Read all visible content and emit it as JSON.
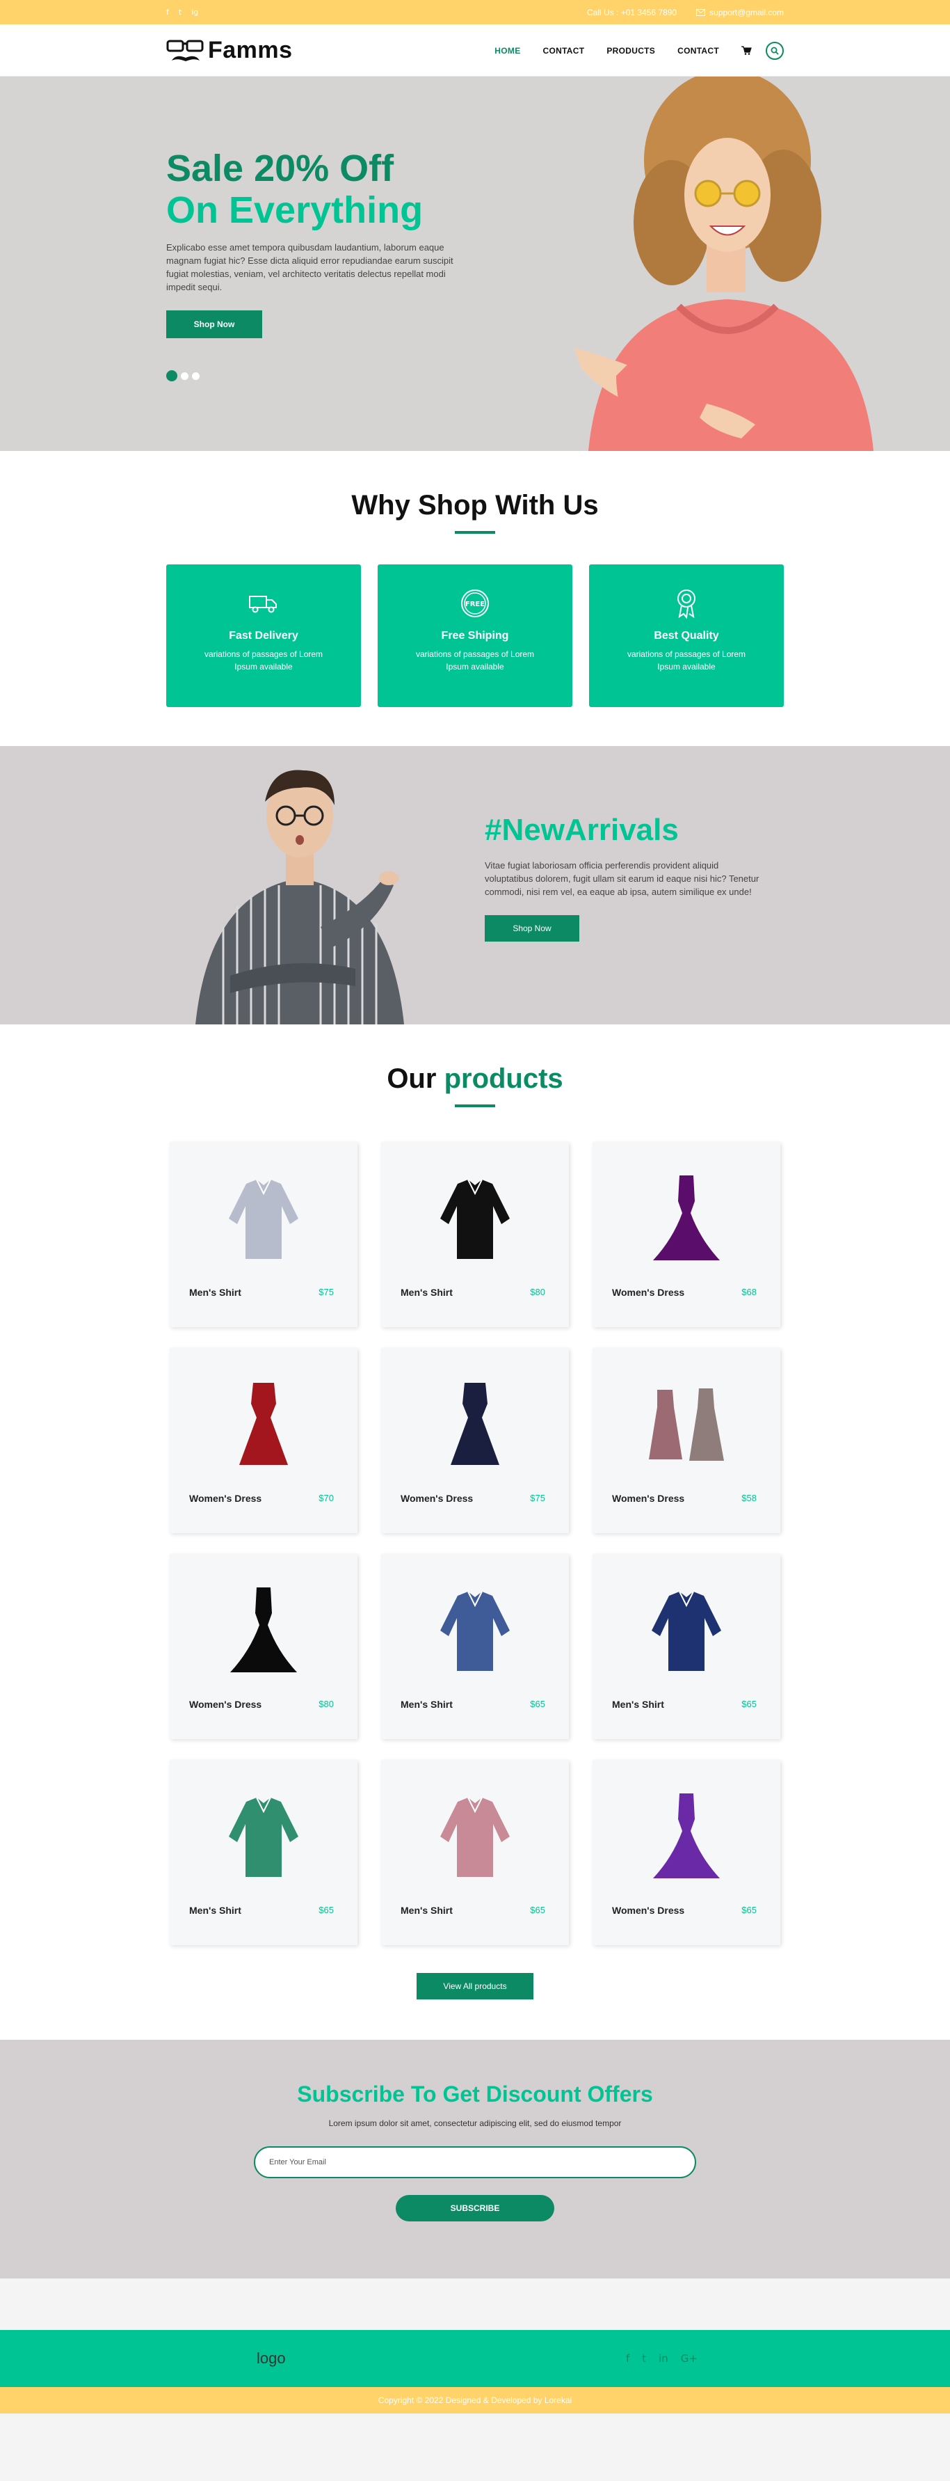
{
  "topbar": {
    "social": [
      "f",
      "t",
      "ig"
    ],
    "phone": "Call Us : +01 3456 7890",
    "email": "support@gmail.com"
  },
  "header": {
    "logo_text": "Famms",
    "nav": [
      "HOME",
      "CONTACT",
      "PRODUCTS",
      "CONTACT"
    ],
    "active": "HOME"
  },
  "hero": {
    "line1": "Sale 20% Off",
    "line2": "On Everything",
    "description": "Explicabo esse amet tempora quibusdam laudantium, laborum eaque magnam fugiat hic? Esse dicta aliquid error repudiandae earum suscipit fugiat molestias, veniam, vel architecto veritatis delectus repellat modi impedit sequi.",
    "button": "Shop Now",
    "slides": 3,
    "active_slide": 1
  },
  "why": {
    "title": "Why Shop With Us",
    "cards": [
      {
        "title": "Fast Delivery",
        "text": "variations of passages of Lorem Ipsum available",
        "icon": "truck-icon"
      },
      {
        "title": "Free Shiping",
        "text": "variations of passages of Lorem Ipsum available",
        "icon": "free-badge-icon"
      },
      {
        "title": "Best Quality",
        "text": "variations of passages of Lorem Ipsum available",
        "icon": "quality-medal-icon"
      }
    ]
  },
  "arrivals": {
    "title": "#NewArrivals",
    "description": "Vitae fugiat laboriosam officia perferendis provident aliquid voluptatibus dolorem, fugit ullam sit earum id eaque nisi hic? Tenetur commodi, nisi rem vel, ea eaque ab ipsa, autem similique ex unde!",
    "button": "Shop Now"
  },
  "products": {
    "title_a": "Our",
    "title_b": "products",
    "items": [
      {
        "name": "Men's Shirt",
        "price": "$75",
        "kind": "shirt",
        "color": "#b7bccc"
      },
      {
        "name": "Men's Shirt",
        "price": "$80",
        "kind": "shirt",
        "color": "#111111"
      },
      {
        "name": "Women's Dress",
        "price": "$68",
        "kind": "gown",
        "color": "#5a0d6a"
      },
      {
        "name": "Women's Dress",
        "price": "$70",
        "kind": "dress",
        "color": "#a3161d"
      },
      {
        "name": "Women's Dress",
        "price": "$75",
        "kind": "dress",
        "color": "#1a1f40"
      },
      {
        "name": "Women's Dress",
        "price": "$58",
        "kind": "pair",
        "color": "#9c6a72"
      },
      {
        "name": "Women's Dress",
        "price": "$80",
        "kind": "gown",
        "color": "#0b0b0b"
      },
      {
        "name": "Men's Shirt",
        "price": "$65",
        "kind": "shirt",
        "color": "#3f5c99"
      },
      {
        "name": "Men's Shirt",
        "price": "$65",
        "kind": "shirt",
        "color": "#1e3170"
      },
      {
        "name": "Men's Shirt",
        "price": "$65",
        "kind": "shirt",
        "color": "#2f8f6f"
      },
      {
        "name": "Men's Shirt",
        "price": "$65",
        "kind": "shirt",
        "color": "#c98a98"
      },
      {
        "name": "Women's Dress",
        "price": "$65",
        "kind": "gown",
        "color": "#6a2aa8"
      }
    ],
    "view_all": "View All products"
  },
  "subscribe": {
    "title": "Subscribe To Get Discount Offers",
    "text": "Lorem ipsum dolor sit amet, consectetur adipiscing elit, sed do eiusmod tempor",
    "placeholder": "Enter Your Email",
    "button": "SUBSCRIBE"
  },
  "footer": {
    "logo": "logo",
    "social": [
      "f",
      "t",
      "in",
      "G+"
    ],
    "copyright": "Copyright © 2022 Designed & Developed by Lorekai"
  },
  "colors": {
    "accent": "#0b8a63",
    "accent_light": "#00c493",
    "yellow": "#ffd36a"
  }
}
